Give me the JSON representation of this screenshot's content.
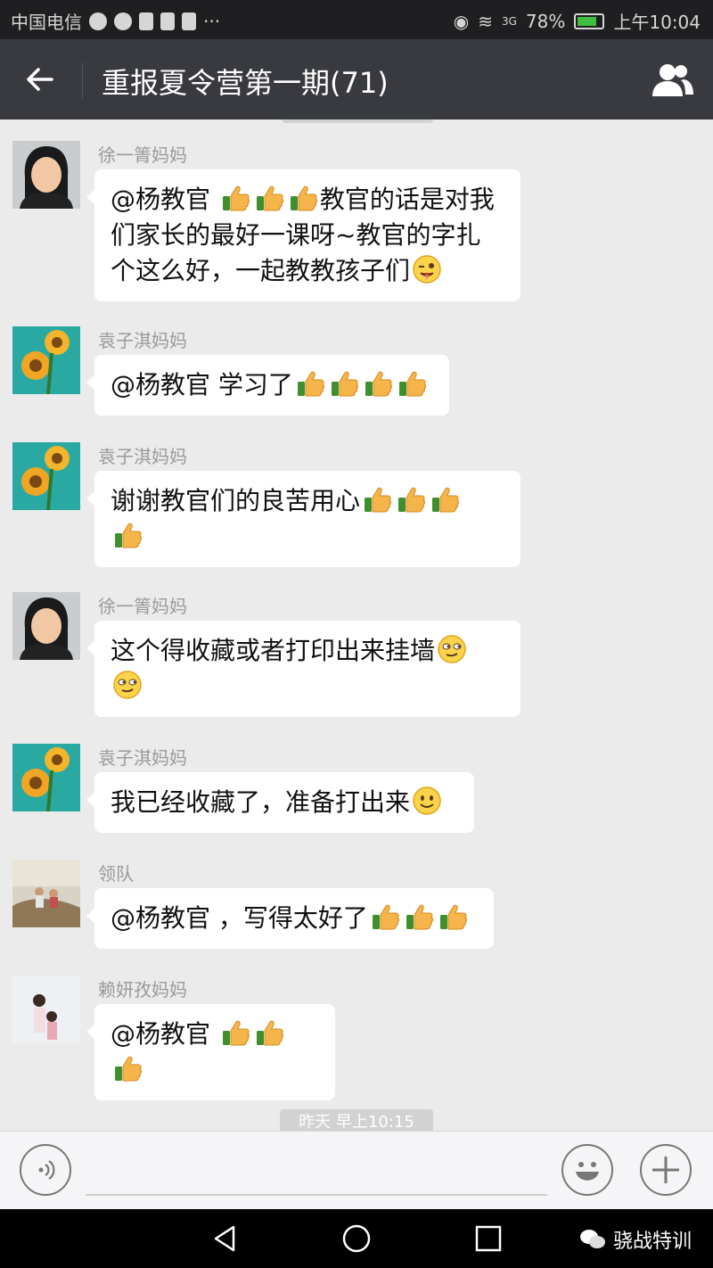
{
  "status_bar": {
    "carrier": "中国电信",
    "battery": "78%",
    "battery_level": 0.78,
    "time": "上午10:04",
    "signal": "3G"
  },
  "header": {
    "title": "重报夏令营第一期(71)",
    "back_icon": "arrow-left-icon",
    "members_icon": "group-members-icon"
  },
  "messages": [
    {
      "sender": "徐一箐妈妈",
      "text_1": "@杨教官 ",
      "text_2": "教官的话是对我",
      "text_3": "们家长的最好一课呀~教官的字扎",
      "text_4": "个这么好，一起教教孩子们"
    },
    {
      "sender": "袁子淇妈妈",
      "text_1": "@杨教官 学习了"
    },
    {
      "sender": "袁子淇妈妈",
      "text_1": "谢谢教官们的良苦用心"
    },
    {
      "sender": "徐一箐妈妈",
      "text_1": "这个得收藏或者打印出来挂墙"
    },
    {
      "sender": "袁子淇妈妈",
      "text_1": "我已经收藏了，准备打出来"
    },
    {
      "sender": "领队",
      "text_1": "@杨教官 ，写得太好了"
    },
    {
      "sender": "赖妍孜妈妈",
      "text_1": "@杨教官 "
    }
  ],
  "timestamp": "昨天 早上10:15",
  "input_bar": {
    "voice_icon": "voice-icon",
    "emoji_icon": "emoji-icon",
    "plus_icon": "plus-icon"
  },
  "nav": {
    "watermark": "骁战特训"
  }
}
